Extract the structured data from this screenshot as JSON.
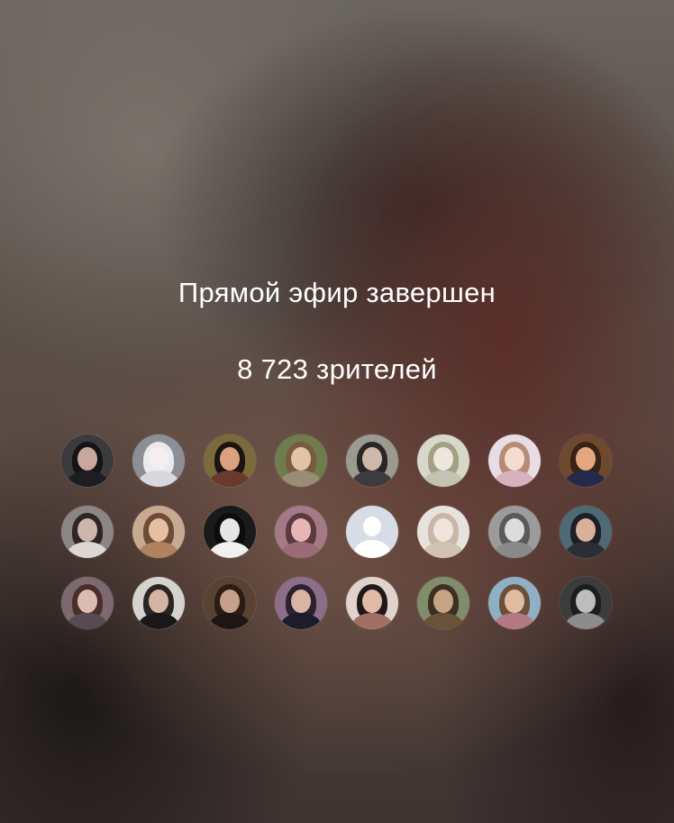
{
  "stream": {
    "ended_text": "Прямой эфир завершен",
    "viewers_text": "8 723 зрителей"
  },
  "avatars": [
    {
      "icon": "viewer-avatar-photo",
      "bg": "#3b3a3d",
      "hair": "#151416",
      "skin": "#c9a79c",
      "body": "#1e1d22"
    },
    {
      "icon": "bunny-avatar-photo",
      "bg": "#8d8f96",
      "hair": "#e9e9ee",
      "skin": "#f4eef0",
      "body": "#d9d8de"
    },
    {
      "icon": "viewer-avatar-photo",
      "bg": "#7a6a3c",
      "hair": "#1a1512",
      "skin": "#d9a27e",
      "body": "#6b3a2e"
    },
    {
      "icon": "viewer-avatar-photo",
      "bg": "#6f7d4c",
      "hair": "#7a5b3e",
      "skin": "#e3c4a6",
      "body": "#9a8d78"
    },
    {
      "icon": "viewer-avatar-photo",
      "bg": "#9b9a8f",
      "hair": "#2a2527",
      "skin": "#cfb8aa",
      "body": "#3e3a40"
    },
    {
      "icon": "viewer-avatar-photo",
      "bg": "#d6d8c9",
      "hair": "#a29f85",
      "skin": "#ece8dc",
      "body": "#c2c3b2"
    },
    {
      "icon": "viewer-avatar-photo",
      "bg": "#e7dde2",
      "hair": "#b58c76",
      "skin": "#f4dccf",
      "body": "#d6b2bf"
    },
    {
      "icon": "viewer-avatar-photo",
      "bg": "#6d4a2e",
      "hair": "#3a2216",
      "skin": "#e2a781",
      "body": "#252a4a"
    },
    {
      "icon": "viewer-avatar-photo",
      "bg": "#8b8584",
      "hair": "#2f2624",
      "skin": "#cdb6ac",
      "body": "#ded7d3"
    },
    {
      "icon": "viewer-avatar-photo",
      "bg": "#c7aa91",
      "hair": "#6e4b35",
      "skin": "#e6c0a2",
      "body": "#b0825f"
    },
    {
      "icon": "viewer-avatar-photo",
      "bg": "#1a1a1a",
      "hair": "#0c0c0c",
      "skin": "#e6e6e6",
      "body": "#f0f0f0"
    },
    {
      "icon": "viewer-avatar-photo",
      "bg": "#a47a86",
      "hair": "#5c3a3e",
      "skin": "#e8b5b7",
      "body": "#9b6b78"
    },
    {
      "icon": "default-user-avatar",
      "bg": "#d7dde6",
      "hair": "",
      "skin": "",
      "body": ""
    },
    {
      "icon": "viewer-avatar-photo",
      "bg": "#e6e2dc",
      "hair": "#c8b7a9",
      "skin": "#efe5dc",
      "body": "#d1c2b3"
    },
    {
      "icon": "viewer-avatar-photo",
      "bg": "#9b9b9b",
      "hair": "#5a5a5a",
      "skin": "#dcdcdc",
      "body": "#8a8a8a"
    },
    {
      "icon": "viewer-avatar-photo",
      "bg": "#4f6a74",
      "hair": "#1c1f26",
      "skin": "#d9b09b",
      "body": "#2b2f33"
    },
    {
      "icon": "viewer-avatar-photo",
      "bg": "#7c6a70",
      "hair": "#4a2e2a",
      "skin": "#dcbcb1",
      "body": "#5a4a52"
    },
    {
      "icon": "viewer-avatar-photo",
      "bg": "#d5d3d0",
      "hair": "#2a2423",
      "skin": "#d4b5a5",
      "body": "#1a1718"
    },
    {
      "icon": "viewer-avatar-photo",
      "bg": "#5a4232",
      "hair": "#2c1d14",
      "skin": "#c6a08a",
      "body": "#1c1614"
    },
    {
      "icon": "viewer-avatar-photo",
      "bg": "#8a6e8a",
      "hair": "#2b2230",
      "skin": "#d8b4a3",
      "body": "#1c1c2a"
    },
    {
      "icon": "viewer-avatar-photo",
      "bg": "#e0d3cc",
      "hair": "#1e1a1a",
      "skin": "#e1b9a7",
      "body": "#a16f64"
    },
    {
      "icon": "viewer-avatar-photo",
      "bg": "#7f8d6a",
      "hair": "#3d2f22",
      "skin": "#c6a585",
      "body": "#6a5238"
    },
    {
      "icon": "viewer-avatar-photo",
      "bg": "#8fb0c4",
      "hair": "#6b4f3a",
      "skin": "#e0bda2",
      "body": "#b37a86"
    },
    {
      "icon": "viewer-avatar-photo",
      "bg": "#3c3c3c",
      "hair": "#1d1d1d",
      "skin": "#bdbdbd",
      "body": "#8c8c8c"
    }
  ]
}
